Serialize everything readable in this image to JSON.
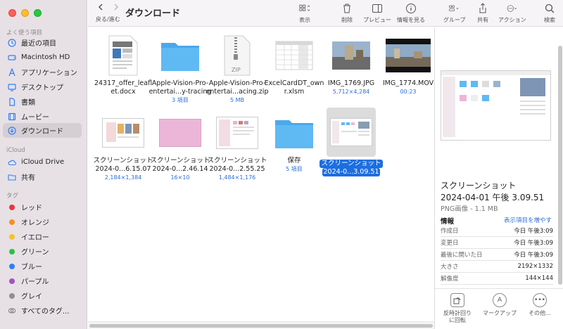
{
  "window": {
    "title": "ダウンロード",
    "back_label": "戻る/進む"
  },
  "toolbar": {
    "view_label": "表示",
    "delete_label": "削除",
    "preview_label": "プレビュー",
    "info_label": "情報を見る",
    "group_label": "グループ",
    "share_label": "共有",
    "action_label": "アクション",
    "search_label": "検索"
  },
  "sidebar": {
    "favorites_header": "よく使う項目",
    "favorites": [
      {
        "label": "最近の項目",
        "icon": "clock-icon"
      },
      {
        "label": "Macintosh HD",
        "icon": "harddrive-icon"
      },
      {
        "label": "アプリケーション",
        "icon": "apps-icon"
      },
      {
        "label": "デスクトップ",
        "icon": "desktop-icon"
      },
      {
        "label": "書類",
        "icon": "document-icon"
      },
      {
        "label": "ムービー",
        "icon": "film-icon"
      },
      {
        "label": "ダウンロード",
        "icon": "download-icon"
      }
    ],
    "icloud_header": "iCloud",
    "icloud": [
      {
        "label": "iCloud Drive",
        "icon": "cloud-icon"
      },
      {
        "label": "共有",
        "icon": "shared-folder-icon"
      }
    ],
    "tags_header": "タグ",
    "tags": [
      {
        "label": "レッド",
        "color": "#f0313a"
      },
      {
        "label": "オレンジ",
        "color": "#f7901e"
      },
      {
        "label": "イエロー",
        "color": "#f6c22c"
      },
      {
        "label": "グリーン",
        "color": "#2bc048"
      },
      {
        "label": "ブルー",
        "color": "#2d7ff9"
      },
      {
        "label": "パープル",
        "color": "#a451c9"
      },
      {
        "label": "グレイ",
        "color": "#8e8e93"
      },
      {
        "label": "すべてのタグ...",
        "icon": "tags-icon"
      }
    ]
  },
  "files": [
    {
      "name1": "24317_offer_leafl",
      "name2": "et.docx",
      "sub": ""
    },
    {
      "name1": "Apple-Vision-Pro-",
      "name2": "entertai...y-tracing",
      "sub": "3 項目"
    },
    {
      "name1": "Apple-Vision-Pro-",
      "name2": "entertai...acing.zip",
      "sub": "5 MB",
      "badge": "ZIP"
    },
    {
      "name1": "ExcelCardDT_own",
      "name2": "r.xlsm",
      "sub": ""
    },
    {
      "name1": "IMG_1769.JPG",
      "name2": "",
      "sub": "5,712×4,284"
    },
    {
      "name1": "IMG_1774.MOV",
      "name2": "",
      "sub": "00:23"
    },
    {
      "name1": "スクリーンショット",
      "name2": "2024-0...6.15.07",
      "sub": "2,184×1,384"
    },
    {
      "name1": "スクリーンショット",
      "name2": "2024-0...2.46.14",
      "sub": "16×10"
    },
    {
      "name1": "スクリーンショット",
      "name2": "2024-0...2.55.25",
      "sub": "1,484×1,176"
    },
    {
      "name1": "保存",
      "name2": "",
      "sub": "5 項目"
    },
    {
      "name1": "スクリーンショット",
      "name2": "2024-0...3.09.51",
      "sub": ""
    }
  ],
  "preview": {
    "title_line1": "スクリーンショット",
    "title_line2": "2024-04-01 午後 3.09.51",
    "kind": "PNG画像 - 1.1 MB",
    "info_header": "情報",
    "show_more": "表示項目を増やす",
    "rows": [
      {
        "k": "作成日",
        "v": "今日 午後3:09"
      },
      {
        "k": "変更日",
        "v": "今日 午後3:09"
      },
      {
        "k": "最後に開いた日",
        "v": "今日 午後3:09"
      },
      {
        "k": "大きさ",
        "v": "2192×1332"
      },
      {
        "k": "解像度",
        "v": "144×144"
      }
    ],
    "actions": [
      {
        "label1": "反時計回り",
        "label2": "に回転"
      },
      {
        "label1": "マークアップ",
        "label2": ""
      },
      {
        "label1": "その他...",
        "label2": ""
      }
    ]
  }
}
